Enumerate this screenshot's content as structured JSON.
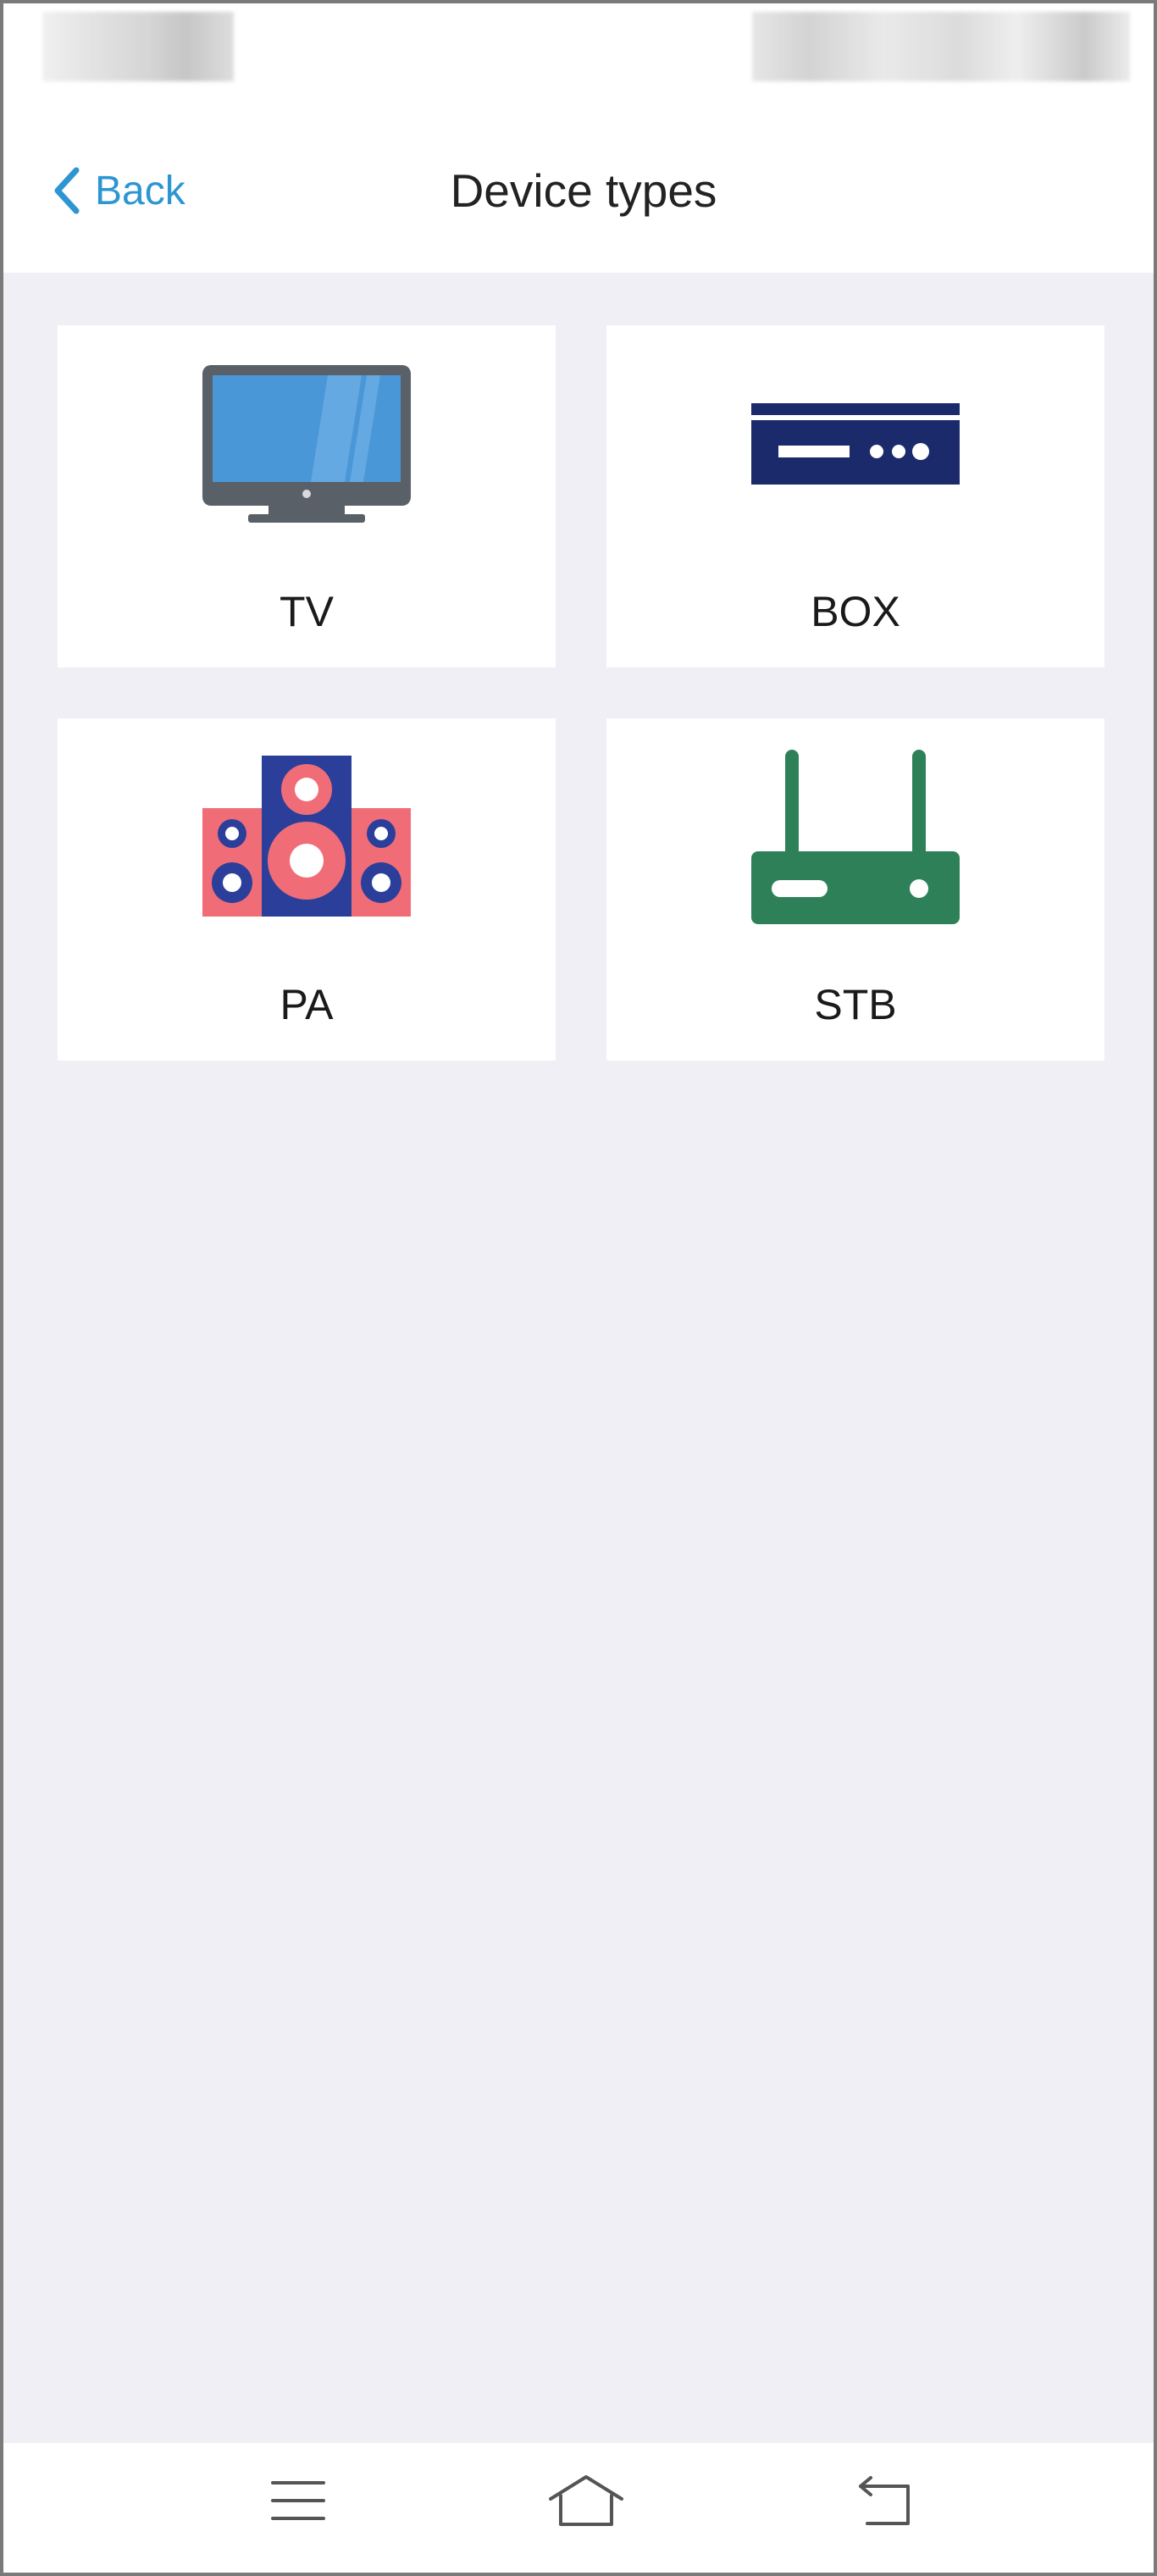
{
  "header": {
    "back_label": "Back",
    "title": "Device types"
  },
  "device_types": [
    {
      "label": "TV",
      "icon": "tv-icon"
    },
    {
      "label": "BOX",
      "icon": "box-icon"
    },
    {
      "label": "PA",
      "icon": "speaker-icon"
    },
    {
      "label": "STB",
      "icon": "router-icon"
    }
  ],
  "bottom_nav": [
    {
      "icon": "menu-icon"
    },
    {
      "icon": "home-icon"
    },
    {
      "icon": "return-icon"
    }
  ],
  "colors": {
    "accent": "#2d96d2",
    "background": "#efeff5",
    "tv_screen": "#4a97d8",
    "tv_frame": "#5a6068",
    "box": "#1b2a6b",
    "speaker_red": "#f06d78",
    "speaker_blue": "#2b3f9a",
    "stb_green": "#2e8058"
  }
}
